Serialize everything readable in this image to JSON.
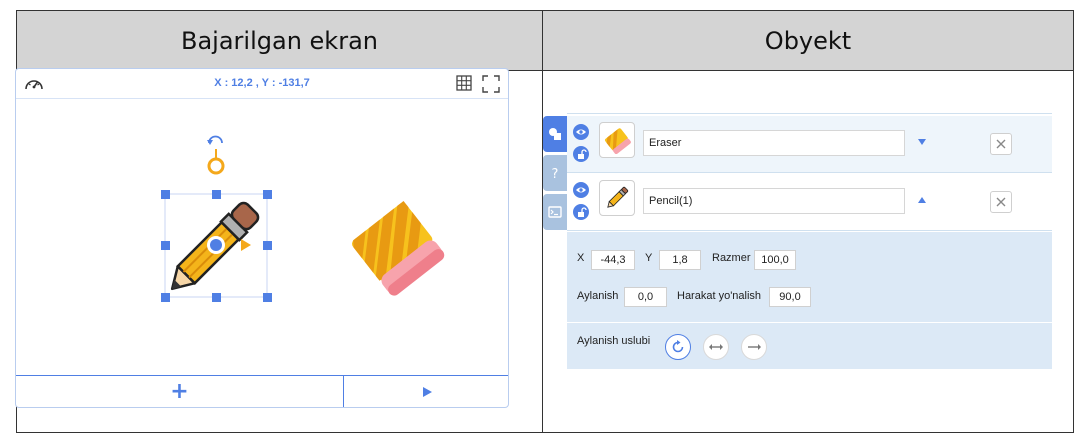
{
  "table": {
    "left_header": "Bajarilgan ekran",
    "right_header": "Obyekt"
  },
  "stage": {
    "coordinates": "X : 12,2 , Y : -131,7",
    "add_label": "+",
    "icons": [
      "speedometer-icon",
      "grid-icon",
      "fullscreen-icon",
      "play-icon"
    ],
    "sprites": [
      "pencil",
      "eraser"
    ]
  },
  "objects": [
    {
      "name": "Eraser",
      "expanded": false
    },
    {
      "name": "Pencil(1)",
      "expanded": true
    }
  ],
  "side_tabs": [
    "object-tab",
    "help-tab",
    "terminal-tab"
  ],
  "properties": {
    "x_label": "X",
    "x_value": "-44,3",
    "y_label": "Y",
    "y_value": "1,8",
    "size_label": "Razmer",
    "size_value": "100,0",
    "rotation_label": "Aylanish",
    "rotation_value": "0,0",
    "direction_label": "Harakat yo'nalish",
    "direction_value": "90,0",
    "rotation_style_label": "Aylanish uslubi",
    "rotation_styles": [
      "free-rotate",
      "left-right",
      "no-rotate"
    ],
    "active_rotation_style": "free-rotate"
  },
  "colors": {
    "accent": "#4f7fe4",
    "panel_bg": "#dce9f6",
    "header_bg": "#d4d4d4",
    "selection_handle": "#4f7fe4",
    "rotation_handle": "#f4a81b"
  }
}
